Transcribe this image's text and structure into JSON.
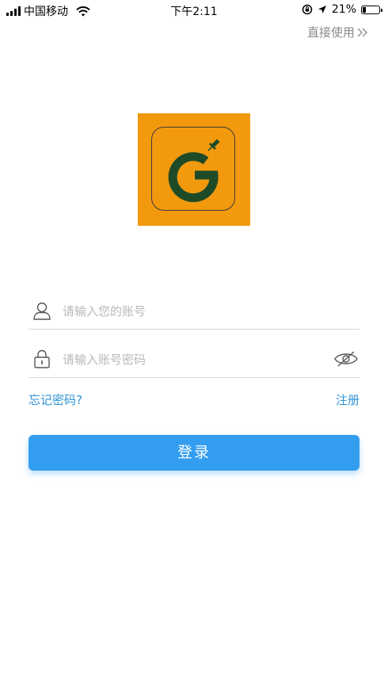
{
  "status_bar": {
    "carrier": "中国移动",
    "time": "下午2:11",
    "battery_percent": "21%",
    "battery_level": 0.21,
    "icons": [
      "signal-icon",
      "wifi-icon",
      "rotation-lock-icon",
      "location-arrow-icon",
      "battery-icon"
    ]
  },
  "header": {
    "skip_label": "直接使用"
  },
  "logo": {
    "background_color": "#f2990e",
    "letter_color": "#1f4a27"
  },
  "form": {
    "username_placeholder": "请输入您的账号",
    "username_value": "",
    "password_placeholder": "请输入账号密码",
    "password_value": "",
    "forgot_password_label": "忘记密码?",
    "register_label": "注册",
    "login_label": "登录"
  },
  "colors": {
    "accent": "#339df0",
    "link": "#2f93d6"
  }
}
